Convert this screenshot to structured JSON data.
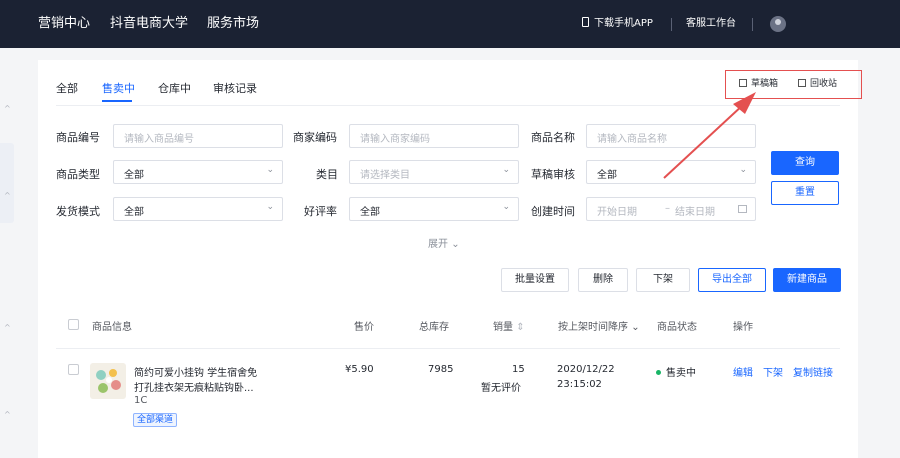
{
  "topbar": {
    "nav": [
      "营销中心",
      "抖音电商大学",
      "服务市场"
    ],
    "download_app": "下载手机APP",
    "service": "客服工作台"
  },
  "tabs": [
    "全部",
    "售卖中",
    "仓库中",
    "审核记录"
  ],
  "active_tab": "售卖中",
  "utils": {
    "drafts": "草稿箱",
    "recycle": "回收站"
  },
  "filters": {
    "product_id": {
      "label": "商品编号",
      "placeholder": "请输入商品编号"
    },
    "merchant_code": {
      "label": "商家编码",
      "placeholder": "请输入商家编码"
    },
    "product_name": {
      "label": "商品名称",
      "placeholder": "请输入商品名称"
    },
    "product_type": {
      "label": "商品类型",
      "value": "全部"
    },
    "category": {
      "label": "类目",
      "placeholder": "请选择类目"
    },
    "draft_review": {
      "label": "草稿审核",
      "value": "全部"
    },
    "ship_mode": {
      "label": "发货模式",
      "value": "全部"
    },
    "rating": {
      "label": "好评率",
      "value": "全部"
    },
    "created_time": {
      "label": "创建时间",
      "start": "开始日期",
      "end": "结束日期",
      "dash": "–"
    }
  },
  "expand": "展开",
  "buttons": {
    "query": "查询",
    "reset": "重置",
    "batch": "批量设置",
    "delete": "删除",
    "unlist": "下架",
    "export": "导出全部",
    "new": "新建商品"
  },
  "table": {
    "headers": [
      "商品信息",
      "售价",
      "总库存",
      "销量",
      "按上架时间降序",
      "商品状态",
      "操作"
    ],
    "rows": [
      {
        "title_line1": "简约可爱小挂钩 学生宿舍免",
        "title_line2": "打孔挂衣架无痕粘贴钩卧...",
        "code": "1C",
        "channel": "全部渠道",
        "price": "¥5.90",
        "stock": "7985",
        "sales": "15",
        "rating": "暂无评价",
        "date": "2020/12/22",
        "time": "23:15:02",
        "status": "售卖中",
        "actions": [
          "编辑",
          "下架",
          "复制链接"
        ]
      }
    ]
  },
  "colors": {
    "primary": "#1966ff",
    "topbar": "#1b2233",
    "annotation": "#e45050",
    "status": "#18b566"
  }
}
